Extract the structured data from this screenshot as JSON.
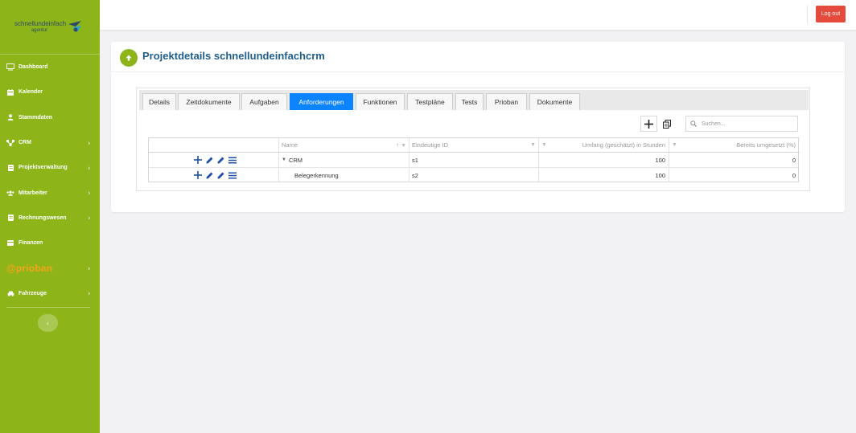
{
  "brand": {
    "name": "schnellundeinfach",
    "sub": "agentur"
  },
  "sidebar": {
    "items": [
      {
        "label": "Dashboard",
        "icon": "monitor-icon",
        "chevron": false
      },
      {
        "label": "Kalender",
        "icon": "calendar-icon",
        "chevron": false
      },
      {
        "label": "Stammdaten",
        "icon": "user-icon",
        "chevron": false
      },
      {
        "label": "CRM",
        "icon": "network-icon",
        "chevron": true
      },
      {
        "label": "Projektverwaltung",
        "icon": "folder-icon",
        "chevron": true
      },
      {
        "label": "Mitarbeiter",
        "icon": "users-icon",
        "chevron": true
      },
      {
        "label": "Rechnungswesen",
        "icon": "invoice-icon",
        "chevron": true
      },
      {
        "label": "Finanzen",
        "icon": "finance-icon",
        "chevron": false
      },
      {
        "label": "@prioban",
        "icon": "prioban-logo",
        "chevron": true
      },
      {
        "label": "Fahrzeuge",
        "icon": "car-icon",
        "chevron": true
      }
    ],
    "collapse_symbol": "‹"
  },
  "topbar": {
    "logout_label": "Log out"
  },
  "page": {
    "title": "Projektdetails schnellundeinfachcrm"
  },
  "tabs": [
    {
      "label": "Details"
    },
    {
      "label": "Zeitdokumente"
    },
    {
      "label": "Aufgaben"
    },
    {
      "label": "Anforderungen",
      "active": true
    },
    {
      "label": "Funktionen"
    },
    {
      "label": "Testpläne"
    },
    {
      "label": "Tests"
    },
    {
      "label": "Prioban"
    },
    {
      "label": "Dokumente"
    }
  ],
  "search": {
    "placeholder": "Suchen..."
  },
  "table": {
    "columns": [
      "",
      "Name",
      "Eindeutige ID",
      "Umfang (geschätzt) in Stunden",
      "Bereits umgesetzt (%)"
    ],
    "rows": [
      {
        "name": "CRM",
        "id": "s1",
        "hours": "100",
        "done": "0",
        "expanded": true,
        "level": 0
      },
      {
        "name": "Belegerkennung",
        "id": "s2",
        "hours": "100",
        "done": "0",
        "level": 1
      }
    ]
  },
  "colors": {
    "sidebar": "#8db51a",
    "accent": "#0d84ff",
    "title": "#1f5e8c",
    "logout": "#e54b3c",
    "prioban": "#f6a21a"
  }
}
